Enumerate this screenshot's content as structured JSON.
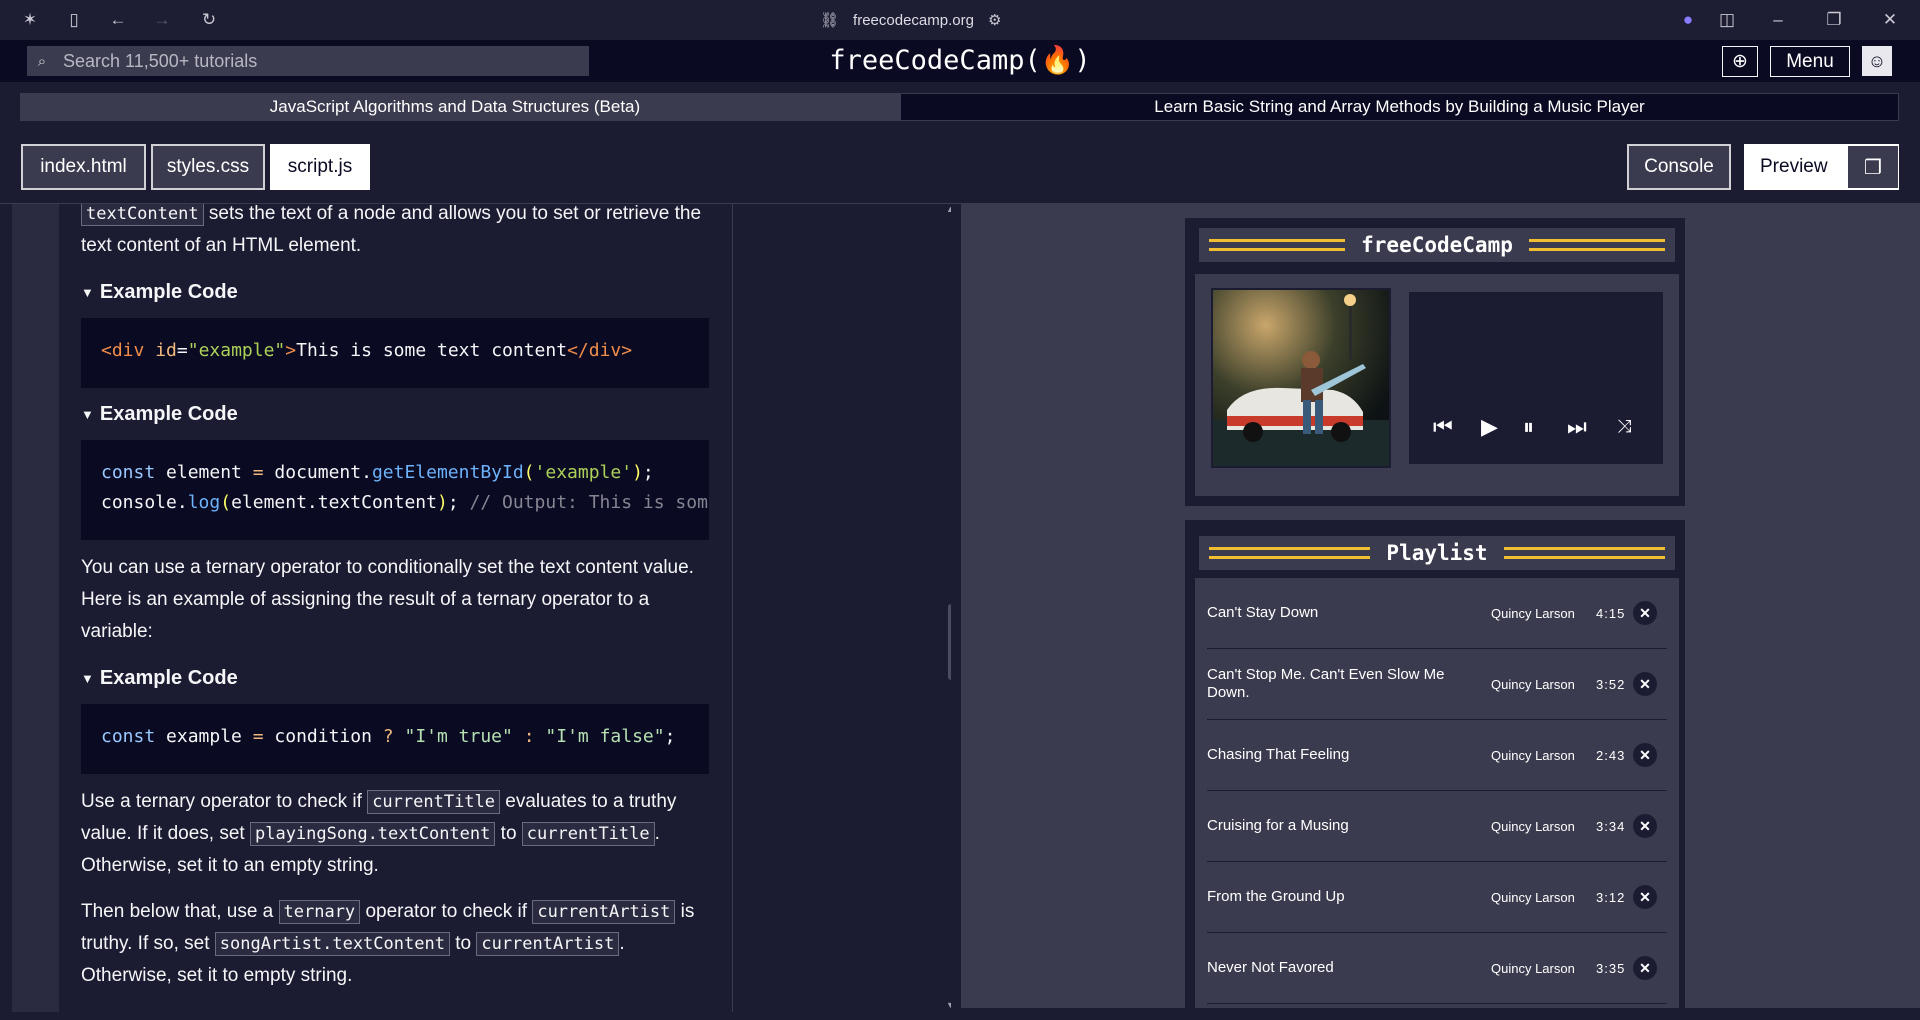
{
  "browser": {
    "url": "freecodecamp.org"
  },
  "nav": {
    "search_placeholder": "Search 11,500+ tutorials",
    "logo": "freeCodeCamp(🔥)",
    "menu_label": "Menu"
  },
  "breadcrumb": {
    "superblock": "JavaScript Algorithms and Data Structures (Beta)",
    "block": "Learn Basic String and Array Methods by Building a Music Player"
  },
  "tabs": {
    "index": "index.html",
    "styles": "styles.css",
    "script": "script.js",
    "console": "Console",
    "preview": "Preview"
  },
  "instructions": {
    "p1_code": "textContent",
    "p1_text": " sets the text of a node and allows you to set or retrieve the text content of an HTML element.",
    "example_title": "Example Code",
    "p2": "You can use a ternary operator to conditionally set the text content value. Here is an example of assigning the result of a ternary operator to a variable:",
    "p3_a": "Use a ternary operator to check if ",
    "p3_code1": "currentTitle",
    "p3_b": " evaluates to a truthy value. If it does, set ",
    "p3_code2": "playingSong.textContent",
    "p3_c": " to ",
    "p3_code3": "currentTitle",
    "p3_d": ". Otherwise, set it to an empty string.",
    "p4_a": "Then below that, use a ",
    "p4_code1": "ternary",
    "p4_b": " operator to check if ",
    "p4_code2": "currentArtist",
    "p4_c": " is truthy. If so, set ",
    "p4_code3": "songArtist.textContent",
    "p4_d": " to ",
    "p4_code4": "currentArtist",
    "p4_e": ". Otherwise, set it to empty string."
  },
  "preview": {
    "player_title": "freeCodeCamp",
    "playlist_title": "Playlist",
    "songs": [
      {
        "title": "Can't Stay Down",
        "artist": "Quincy Larson",
        "duration": "4:15"
      },
      {
        "title": "Can't Stop Me. Can't Even Slow Me Down.",
        "artist": "Quincy Larson",
        "duration": "3:52"
      },
      {
        "title": "Chasing That Feeling",
        "artist": "Quincy Larson",
        "duration": "2:43"
      },
      {
        "title": "Cruising for a Musing",
        "artist": "Quincy Larson",
        "duration": "3:34"
      },
      {
        "title": "From the Ground Up",
        "artist": "Quincy Larson",
        "duration": "3:12"
      },
      {
        "title": "Never Not Favored",
        "artist": "Quincy Larson",
        "duration": "3:35"
      }
    ]
  },
  "colors": {
    "accent_gold": "#f1be32",
    "bg_dark": "#0a0a23",
    "bg_mid": "#1b1b32",
    "bg_gray": "#3b3b4f"
  }
}
